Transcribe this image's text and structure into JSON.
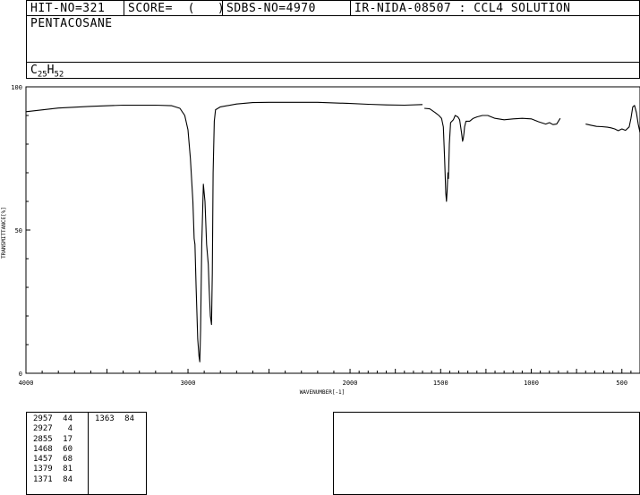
{
  "header": {
    "hit_no": "HIT-NO=321",
    "score": "SCORE=  (   )",
    "sdbs_no": "SDBS-NO=4970",
    "source": "IR-NIDA-08507 : CCL4 SOLUTION"
  },
  "compound": {
    "name": "PENTACOSANE",
    "formula_c": "C",
    "formula_c_sub": "25",
    "formula_h": "H",
    "formula_h_sub": "52"
  },
  "chart_data": {
    "type": "line",
    "xlabel": "WAVENUMBER[-1]",
    "ylabel": "TRANSMITTANCE[%]",
    "xlim": [
      4000,
      400
    ],
    "ylim": [
      0,
      100
    ],
    "x_ticks": [
      "4000",
      "3000",
      "2000",
      "1500",
      "1000",
      "500"
    ],
    "y_ticks": [
      "100",
      "50",
      "0"
    ],
    "x_scale": "split linear: 500 cm-1 per division above 2000, 250 cm-1 per division below 2000",
    "grid": false,
    "series": [
      {
        "x": [
          4000,
          3800,
          3600,
          3400,
          3200,
          3100,
          3050,
          3020,
          3000,
          2985,
          2970,
          2962,
          2957,
          2950,
          2940,
          2932,
          2927,
          2922,
          2915,
          2905,
          2895,
          2885,
          2875,
          2870,
          2862,
          2855,
          2850,
          2845,
          2838,
          2830,
          2800,
          2700,
          2600,
          2500,
          2400,
          2200,
          2000,
          1900,
          1800,
          1700,
          1600
        ],
        "y": [
          91.3,
          92.6,
          93.2,
          93.6,
          93.6,
          93.4,
          92.5,
          90,
          85,
          75,
          60,
          47,
          45,
          30,
          12,
          6,
          4,
          15,
          45,
          66,
          60,
          45,
          38,
          30,
          20,
          17,
          35,
          70,
          88,
          92,
          93,
          94,
          94.5,
          94.6,
          94.6,
          94.6,
          94.2,
          93.9,
          93.7,
          93.6,
          93.8
        ]
      },
      {
        "x": [
          1590,
          1560,
          1530,
          1510,
          1495,
          1485,
          1478,
          1472,
          1468,
          1464,
          1460,
          1457,
          1452,
          1445,
          1430,
          1420,
          1405,
          1395,
          1385,
          1379,
          1375,
          1371,
          1368,
          1360,
          1340,
          1320,
          1300,
          1270,
          1240,
          1200,
          1150,
          1100,
          1050,
          1000,
          960,
          920,
          900,
          880,
          860,
          840
        ],
        "y": [
          92.5,
          92.3,
          91.0,
          90.0,
          89.0,
          86.0,
          75.0,
          63.0,
          60.0,
          64.0,
          70.0,
          68.0,
          80.0,
          87.5,
          88.5,
          90.0,
          89.5,
          88.5,
          84.0,
          81.0,
          82.0,
          84.0,
          86.0,
          88.0,
          88.0,
          89.0,
          89.5,
          90.0,
          90.0,
          89.0,
          88.5,
          88.8,
          89.0,
          88.8,
          87.8,
          87.0,
          87.5,
          86.8,
          87.0,
          89.0
        ]
      },
      {
        "x": [
          700,
          670,
          640,
          610,
          580,
          560,
          540,
          520,
          500,
          480,
          460,
          450,
          440,
          430,
          420,
          410,
          400
        ],
        "y": [
          87.0,
          86.6,
          86.2,
          86.1,
          85.9,
          85.7,
          85.3,
          84.7,
          85.3,
          84.8,
          86.0,
          89.0,
          93.0,
          93.5,
          91.0,
          87.0,
          84.0
        ]
      }
    ]
  },
  "peaks": {
    "col1": [
      {
        "wn": "2957",
        "t": "44"
      },
      {
        "wn": "2927",
        "t": "4"
      },
      {
        "wn": "2855",
        "t": "17"
      },
      {
        "wn": "1468",
        "t": "60"
      },
      {
        "wn": "1457",
        "t": "68"
      },
      {
        "wn": "1379",
        "t": "81"
      },
      {
        "wn": "1371",
        "t": "84"
      }
    ],
    "col2": [
      {
        "wn": "1363",
        "t": "84"
      }
    ]
  }
}
